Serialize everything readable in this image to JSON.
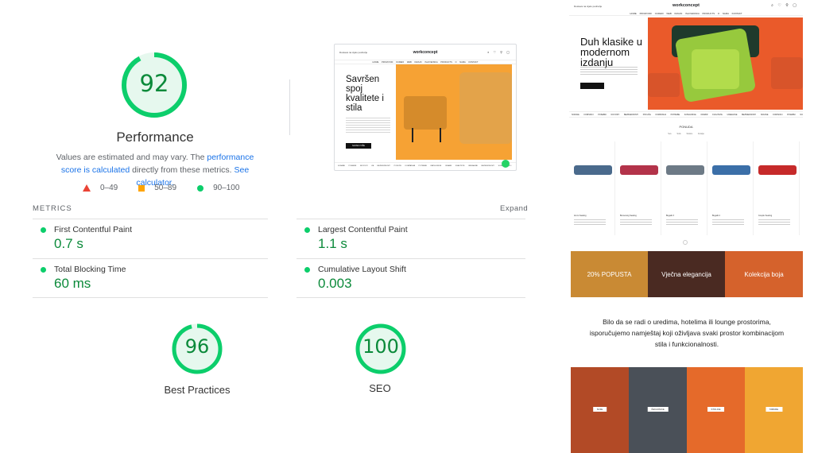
{
  "lighthouse": {
    "performance": {
      "score": "92",
      "label": "Performance",
      "fraction": 0.92
    },
    "description": {
      "part1": "Values are estimated and may vary. The ",
      "link1": "performance score is calculated",
      "part2": " directly from these metrics. ",
      "link2": "See calculator."
    },
    "legend": {
      "fail": "0–49",
      "average": "50–89",
      "pass": "90–100"
    },
    "metrics_heading": "METRICS",
    "expand_label": "Expand",
    "metrics": [
      {
        "label": "First Contentful Paint",
        "value": "0.7 s"
      },
      {
        "label": "Largest Contentful Paint",
        "value": "1.1 s"
      },
      {
        "label": "Total Blocking Time",
        "value": "60 ms"
      },
      {
        "label": "Cumulative Layout Shift",
        "value": "0.003"
      }
    ],
    "best_practices": {
      "score": "96",
      "label": "Best Practices",
      "fraction": 0.96
    },
    "seo": {
      "score": "100",
      "label": "SEO",
      "fraction": 1.0
    },
    "colors": {
      "pass": "#0cce6b",
      "average": "#ffa400",
      "fail": "#ea4335",
      "pass_text": "#0b8a3a"
    }
  },
  "preview": {
    "topline": "Dostava na cijelo područje",
    "logo": "workconcept",
    "icons": "⌕ ♡ ⚲ ▢",
    "nav": "HOME PROIZVODI OUREDI WEB DIZAJN ISLOVENSKA PRODUCTS O NAMA KONTAKT",
    "hero_title": "Savršen spoj kvalitete i stila",
    "button": "SAZNAJ VIŠE",
    "bottom_bar": "SOFANE   POSEBNI NOVOSTI ZA BEZBJEDNOSTI   POKUĆE KOMPANIJA POTREBE   KATEGORIJE ODABIR KVALITETE   UREĐAJNE BEZBJEDNOSTI   SOFANE KO",
    "whatsapp_icon": "whatsapp-icon"
  },
  "fullpage": {
    "topline": "Dostava na cijelo područje",
    "logo": "workconcept",
    "icons": "⌕ ♡ ⚲ ▢",
    "nav": "HOME PROIZVODI OUREDI WEB DIZAJN ISLOVENSKA PRODUCTS O NAMA KONTAKT",
    "hero_title": "Duh klasike u modernom izdanju",
    "categories": "SOFANE KORISNICI   POSEBNI NOVOSTI BEZBJEDNOSTI   POKUĆE KOMPANIJA POTREBE   KATEGORIJE ODABIR KVALITETE   UREĐAJNE BEZBJEDNOSTI   SOFANE KORISNICI   POSEBNI NOVOSTI",
    "ponuda": "PONUDA",
    "tabs": "Sve Sofe Stolice Fotelje",
    "products": [
      {
        "name": "Amco Seating",
        "color": "#4a6a8c"
      },
      {
        "name": "Bumerang Seating",
        "color": "#b3334a"
      },
      {
        "name": "Bugatti 3",
        "color": "#6d7a86"
      },
      {
        "name": "Bugatti 2",
        "color": "#3b6fa8"
      },
      {
        "name": "Couple Seating",
        "color": "#c62a2a"
      }
    ],
    "banners": [
      {
        "label": "20% POPUSTA",
        "color": "#c98a34"
      },
      {
        "label": "Vječna elegancija",
        "color": "#4a2a22"
      },
      {
        "label": "Kolekcija boja",
        "color": "#d5622c"
      }
    ],
    "paragraph": "Bilo da se radi o uredima, hotelima ili lounge prostorima, isporučujemo namještaj koji oživljava svaki prostor kombinacijom stila i funkcionalnosti.",
    "tiles": [
      {
        "label": "SOFE",
        "color": "#b24a26"
      },
      {
        "label": "ČEKAONICE",
        "color": "#4a5058"
      },
      {
        "label": "STOLICE",
        "color": "#e56a2a"
      },
      {
        "label": "TABURE",
        "color": "#f0a632"
      }
    ]
  }
}
